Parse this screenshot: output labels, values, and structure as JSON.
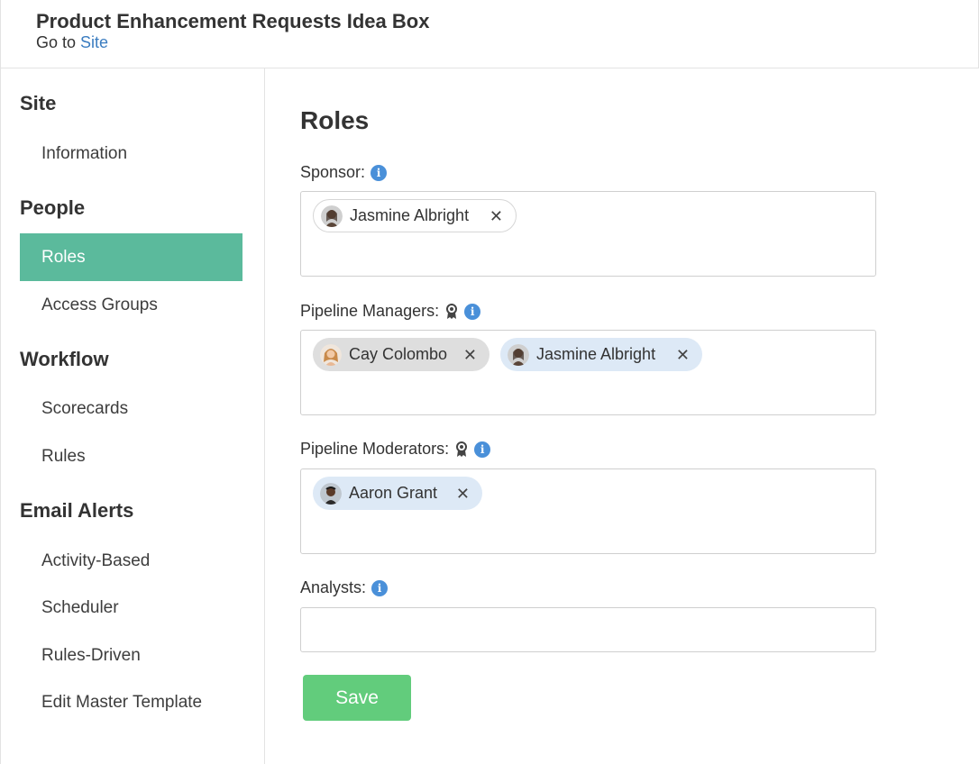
{
  "header": {
    "title": "Product Enhancement Requests Idea Box",
    "goto_prefix": "Go to",
    "goto_link": "Site"
  },
  "sidebar": {
    "sections": [
      {
        "title": "Site",
        "items": [
          "Information"
        ]
      },
      {
        "title": "People",
        "items": [
          "Roles",
          "Access Groups"
        ]
      },
      {
        "title": "Workflow",
        "items": [
          "Scorecards",
          "Rules"
        ]
      },
      {
        "title": "Email Alerts",
        "items": [
          "Activity-Based",
          "Scheduler",
          "Rules-Driven",
          "Edit Master Template"
        ]
      }
    ],
    "active_item": "Roles"
  },
  "main": {
    "heading": "Roles",
    "fields": {
      "sponsor": {
        "label": "Sponsor:",
        "chips": [
          {
            "name": "Jasmine Albright"
          }
        ]
      },
      "pipeline_managers": {
        "label": "Pipeline Managers:",
        "chips": [
          {
            "name": "Cay Colombo"
          },
          {
            "name": "Jasmine Albright"
          }
        ]
      },
      "pipeline_moderators": {
        "label": "Pipeline Moderators:",
        "chips": [
          {
            "name": "Aaron Grant"
          }
        ]
      },
      "analysts": {
        "label": "Analysts:",
        "value": ""
      }
    },
    "save_label": "Save"
  },
  "colors": {
    "accent": "#5bba9c",
    "link": "#3a7cc0",
    "info_icon": "#4a90d9",
    "save_button": "#62cc7c",
    "chip_blue": "#dde9f6",
    "chip_gray": "#dedede"
  },
  "icons": {
    "info": "info-icon",
    "award": "award-ribbon-icon",
    "remove": "close-icon"
  }
}
